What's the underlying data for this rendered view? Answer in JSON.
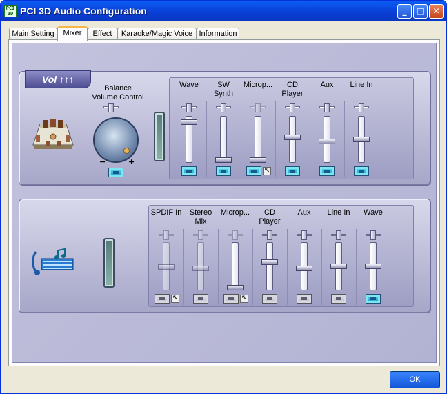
{
  "window": {
    "title": "PCI 3D Audio Configuration",
    "icon_text": "PCI 3D"
  },
  "titlebar_buttons": {
    "minimize": "_",
    "maximize": "□",
    "close": "✕"
  },
  "tabs": [
    {
      "label": "Main Setting",
      "active": false
    },
    {
      "label": "Mixer",
      "active": true
    },
    {
      "label": "Effect",
      "active": false
    },
    {
      "label": "Karaoke/Magic Voice",
      "active": false
    },
    {
      "label": "Information",
      "active": false
    }
  ],
  "playback": {
    "badge": "Vol ↑↑↑",
    "balance_label": "Balance\nVolume Control",
    "minus": "−",
    "plus": "+",
    "master_level": 0.55,
    "channels": [
      {
        "label": "Wave",
        "level": 0.92,
        "muted": false,
        "select": false,
        "enabled": true
      },
      {
        "label": "SW\nSynth",
        "level": 0.0,
        "muted": false,
        "select": false,
        "enabled": true
      },
      {
        "label": "Microp...",
        "level": 0.0,
        "muted": false,
        "select": true,
        "enabled": true,
        "balance_disabled": true
      },
      {
        "label": "CD\nPlayer",
        "level": 0.55,
        "muted": false,
        "select": false,
        "enabled": true
      },
      {
        "label": "Aux",
        "level": 0.45,
        "muted": false,
        "select": false,
        "enabled": true
      },
      {
        "label": "Line In",
        "level": 0.5,
        "muted": false,
        "select": false,
        "enabled": true
      }
    ]
  },
  "recording": {
    "channels": [
      {
        "label": "SPDIF In",
        "level": 0.48,
        "muted": true,
        "select": true,
        "enabled": false
      },
      {
        "label": "Stereo\nMix",
        "level": 0.45,
        "muted": true,
        "select": false,
        "enabled": false
      },
      {
        "label": "Microp...",
        "level": 0.0,
        "muted": true,
        "select": true,
        "enabled": true,
        "balance_disabled": true
      },
      {
        "label": "CD\nPlayer",
        "level": 0.6,
        "muted": true,
        "select": false,
        "enabled": true
      },
      {
        "label": "Aux",
        "level": 0.45,
        "muted": true,
        "select": false,
        "enabled": true
      },
      {
        "label": "Line In",
        "level": 0.5,
        "muted": true,
        "select": false,
        "enabled": true
      },
      {
        "label": "Wave",
        "level": 0.5,
        "muted": false,
        "select": false,
        "enabled": true
      }
    ]
  },
  "footer": {
    "ok_label": "OK"
  },
  "colors": {
    "accent": "#0a5ef4",
    "mute_on": "#1a92d6",
    "panel": "#b8b8d6"
  }
}
